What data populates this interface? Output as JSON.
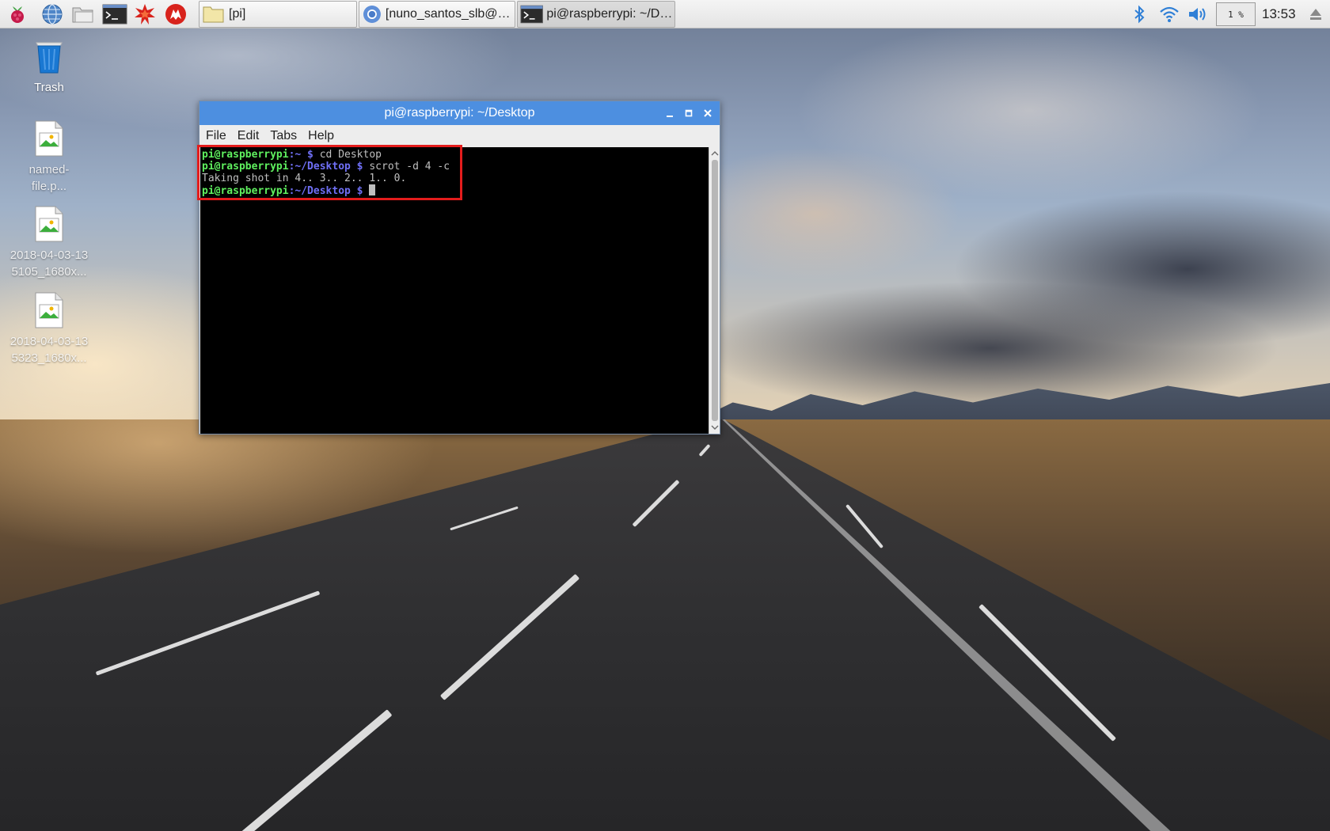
{
  "taskbar": {
    "launchers": [
      {
        "name": "raspberry-menu",
        "icon": "raspberry-icon"
      },
      {
        "name": "web-browser",
        "icon": "globe-icon"
      },
      {
        "name": "file-manager",
        "icon": "folder-icon"
      },
      {
        "name": "terminal",
        "icon": "terminal-icon"
      },
      {
        "name": "mathematica",
        "icon": "mathematica-icon"
      },
      {
        "name": "wolfram",
        "icon": "wolfram-icon"
      }
    ],
    "tasks": [
      {
        "label": "[pi]",
        "icon": "folder-icon",
        "active": false
      },
      {
        "label": "[nuno_santos_slb@h...",
        "icon": "chromium-icon",
        "active": false
      },
      {
        "label": "pi@raspberrypi: ~/De...",
        "icon": "terminal-icon",
        "active": true
      }
    ],
    "tray": {
      "bluetooth_icon": "bluetooth-icon",
      "wifi_icon": "wifi-icon",
      "volume_icon": "volume-icon",
      "cpu_usage": "1 %",
      "clock": "13:53",
      "eject_icon": "eject-icon"
    }
  },
  "desktop": {
    "icons": [
      {
        "label": "Trash",
        "icon": "trash-icon"
      },
      {
        "label_line1": "named-",
        "label_line2": "file.p...",
        "icon": "image-file-icon"
      },
      {
        "label_line1": "2018-04-03-13",
        "label_line2": "5105_1680x...",
        "icon": "image-file-icon"
      },
      {
        "label_line1": "2018-04-03-13",
        "label_line2": "5323_1680x...",
        "icon": "image-file-icon"
      }
    ]
  },
  "window": {
    "title": "pi@raspberrypi: ~/Desktop",
    "menu": [
      "File",
      "Edit",
      "Tabs",
      "Help"
    ],
    "terminal": {
      "lines": [
        {
          "user": "pi@raspberrypi",
          "path": ":~",
          "dollar": " $ ",
          "cmd": "cd Desktop"
        },
        {
          "user": "pi@raspberrypi",
          "path": ":~/Desktop",
          "dollar": " $ ",
          "cmd": "scrot -d 4 -c"
        },
        {
          "output": "Taking shot in 4.. 3.. 2.. 1.. 0."
        },
        {
          "user": "pi@raspberrypi",
          "path": ":~/Desktop",
          "dollar": " $ ",
          "cmd": ""
        }
      ]
    }
  },
  "colors": {
    "titlebar": "#4d8fe0",
    "prompt_user": "#5ff05f",
    "prompt_path": "#6f6ff5",
    "highlight": "#e41c1c"
  }
}
